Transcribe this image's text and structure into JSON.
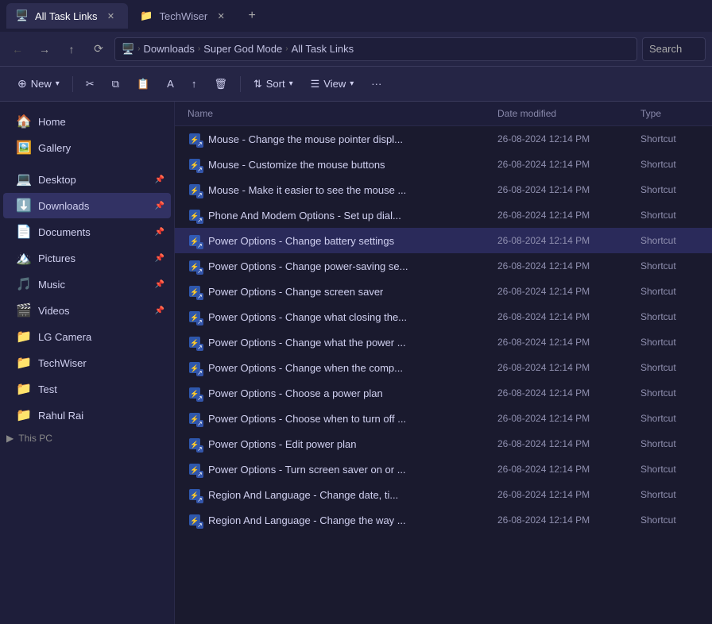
{
  "titleBar": {
    "tabs": [
      {
        "id": "all-task-links",
        "label": "All Task Links",
        "icon": "🖥️",
        "active": true
      },
      {
        "id": "techwiser",
        "label": "TechWiser",
        "icon": "📁",
        "active": false
      }
    ],
    "newTabLabel": "+"
  },
  "addressBar": {
    "backLabel": "←",
    "forwardLabel": "→",
    "upLabel": "↑",
    "refreshLabel": "⟳",
    "breadcrumb": [
      {
        "id": "pc-icon",
        "label": "🖥️"
      },
      {
        "id": "downloads",
        "label": "Downloads"
      },
      {
        "id": "super-god-mode",
        "label": "Super God Mode"
      },
      {
        "id": "all-task-links",
        "label": "All Task Links"
      }
    ],
    "searchPlaceholder": "Search"
  },
  "toolbar": {
    "newLabel": "New",
    "cutLabel": "✂",
    "copyLabel": "⧉",
    "pasteLabel": "📋",
    "renameLabel": "A",
    "shareLabel": "↑",
    "deleteLabel": "🗑",
    "sortLabel": "Sort",
    "viewLabel": "View",
    "moreLabel": "···"
  },
  "fileList": {
    "columns": [
      "Name",
      "Date modified",
      "Type"
    ],
    "files": [
      {
        "name": "Mouse - Change the mouse pointer displ...",
        "date": "26-08-2024 12:14 PM",
        "type": "Shortcut",
        "selected": false
      },
      {
        "name": "Mouse - Customize the mouse buttons",
        "date": "26-08-2024 12:14 PM",
        "type": "Shortcut",
        "selected": false
      },
      {
        "name": "Mouse - Make it easier to see the mouse ...",
        "date": "26-08-2024 12:14 PM",
        "type": "Shortcut",
        "selected": false
      },
      {
        "name": "Phone And Modem Options - Set up dial...",
        "date": "26-08-2024 12:14 PM",
        "type": "Shortcut",
        "selected": false
      },
      {
        "name": "Power Options - Change battery settings",
        "date": "26-08-2024 12:14 PM",
        "type": "Shortcut",
        "selected": true
      },
      {
        "name": "Power Options - Change power-saving se...",
        "date": "26-08-2024 12:14 PM",
        "type": "Shortcut",
        "selected": false
      },
      {
        "name": "Power Options - Change screen saver",
        "date": "26-08-2024 12:14 PM",
        "type": "Shortcut",
        "selected": false
      },
      {
        "name": "Power Options - Change what closing the...",
        "date": "26-08-2024 12:14 PM",
        "type": "Shortcut",
        "selected": false
      },
      {
        "name": "Power Options - Change what the power ...",
        "date": "26-08-2024 12:14 PM",
        "type": "Shortcut",
        "selected": false
      },
      {
        "name": "Power Options - Change when the comp...",
        "date": "26-08-2024 12:14 PM",
        "type": "Shortcut",
        "selected": false
      },
      {
        "name": "Power Options - Choose a power plan",
        "date": "26-08-2024 12:14 PM",
        "type": "Shortcut",
        "selected": false
      },
      {
        "name": "Power Options - Choose when to turn off ...",
        "date": "26-08-2024 12:14 PM",
        "type": "Shortcut",
        "selected": false
      },
      {
        "name": "Power Options - Edit power plan",
        "date": "26-08-2024 12:14 PM",
        "type": "Shortcut",
        "selected": false
      },
      {
        "name": "Power Options - Turn screen saver on or ...",
        "date": "26-08-2024 12:14 PM",
        "type": "Shortcut",
        "selected": false
      },
      {
        "name": "Region And Language - Change date, ti...",
        "date": "26-08-2024 12:14 PM",
        "type": "Shortcut",
        "selected": false
      },
      {
        "name": "Region And Language - Change the way ...",
        "date": "26-08-2024 12:14 PM",
        "type": "Shortcut",
        "selected": false
      }
    ]
  },
  "sidebar": {
    "items": [
      {
        "id": "home",
        "label": "Home",
        "icon": "🏠",
        "pinned": false
      },
      {
        "id": "gallery",
        "label": "Gallery",
        "icon": "🖼️",
        "pinned": false
      },
      {
        "id": "desktop",
        "label": "Desktop",
        "icon": "💻",
        "pinned": true
      },
      {
        "id": "downloads",
        "label": "Downloads",
        "icon": "⬇️",
        "pinned": true,
        "active": true
      },
      {
        "id": "documents",
        "label": "Documents",
        "icon": "📄",
        "pinned": true
      },
      {
        "id": "pictures",
        "label": "Pictures",
        "icon": "🏔️",
        "pinned": true
      },
      {
        "id": "music",
        "label": "Music",
        "icon": "🎵",
        "pinned": true
      },
      {
        "id": "videos",
        "label": "Videos",
        "icon": "🎬",
        "pinned": true
      },
      {
        "id": "lg-camera",
        "label": "LG Camera",
        "icon": "📁",
        "pinned": false
      },
      {
        "id": "techwiser",
        "label": "TechWiser",
        "icon": "📁",
        "pinned": false
      },
      {
        "id": "test",
        "label": "Test",
        "icon": "📁",
        "pinned": false
      },
      {
        "id": "rahul-rai",
        "label": "Rahul Rai",
        "icon": "📁",
        "pinned": false
      }
    ],
    "thisPC": {
      "label": "This PC",
      "expandIcon": "▶"
    }
  }
}
